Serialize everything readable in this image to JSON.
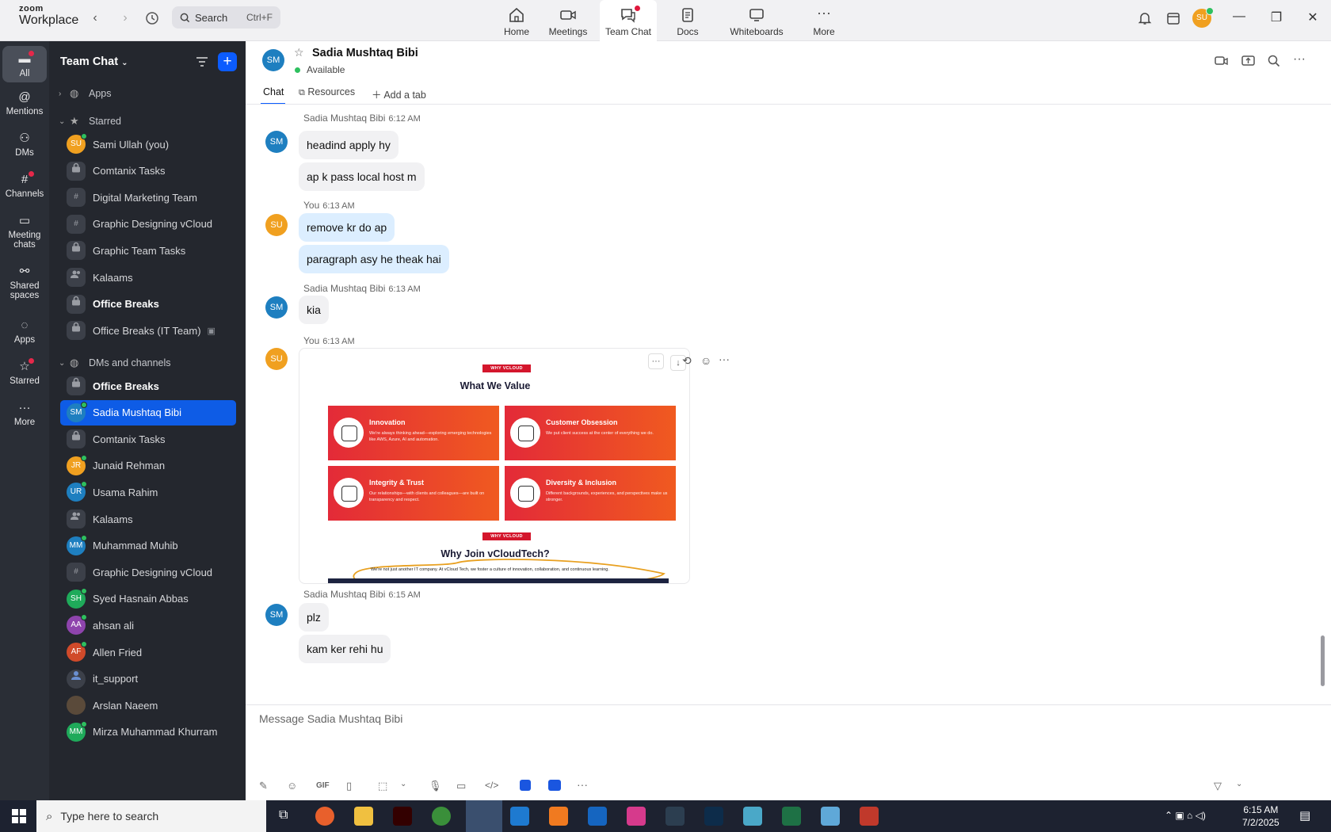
{
  "titlebar": {
    "brand_top": "zoom",
    "brand_bottom": "Workplace",
    "search_placeholder": "Search",
    "search_shortcut": "Ctrl+F",
    "avatar": "SU",
    "nav": [
      {
        "label": "Home"
      },
      {
        "label": "Meetings"
      },
      {
        "label": "Team Chat"
      },
      {
        "label": "Docs"
      },
      {
        "label": "Whiteboards"
      },
      {
        "label": "More"
      }
    ]
  },
  "rail": [
    {
      "label": "All"
    },
    {
      "label": "Mentions"
    },
    {
      "label": "DMs"
    },
    {
      "label": "Channels"
    },
    {
      "label": "Meeting chats"
    },
    {
      "label": "Shared spaces"
    },
    {
      "label": "Apps"
    },
    {
      "label": "Starred"
    },
    {
      "label": "More"
    }
  ],
  "sidebar": {
    "title": "Team Chat",
    "sections": {
      "apps": "Apps",
      "starred": "Starred",
      "dms": "DMs and channels"
    },
    "starred": [
      {
        "name": "Sami Ullah (you)",
        "initials": "SU",
        "color": "#f0a020"
      },
      {
        "name": "Comtanix Tasks",
        "icon": "lock"
      },
      {
        "name": "Digital Marketing Team",
        "icon": "hash"
      },
      {
        "name": "Graphic Designing vCloud",
        "icon": "hash"
      },
      {
        "name": "Graphic Team Tasks",
        "icon": "lock"
      },
      {
        "name": "Kalaams",
        "icon": "people"
      },
      {
        "name": "Office Breaks",
        "icon": "lock"
      },
      {
        "name": "Office Breaks (IT Team)",
        "icon": "lock"
      }
    ],
    "dms": [
      {
        "name": "Office Breaks",
        "icon": "lock"
      },
      {
        "name": "Sadia Mushtaq Bibi",
        "initials": "SM",
        "color": "#1e7fc0"
      },
      {
        "name": "Comtanix Tasks",
        "icon": "lock"
      },
      {
        "name": "Junaid Rehman",
        "initials": "JR",
        "color": "#f0a020"
      },
      {
        "name": "Usama Rahim",
        "initials": "UR",
        "color": "#1e7fc0"
      },
      {
        "name": "Kalaams",
        "icon": "people"
      },
      {
        "name": "Muhammad Muhib",
        "initials": "MM",
        "color": "#1e7fc0"
      },
      {
        "name": "Graphic Designing vCloud",
        "icon": "hash"
      },
      {
        "name": "Syed Hasnain Abbas",
        "initials": "SH",
        "color": "#1faa5a"
      },
      {
        "name": "ahsan ali",
        "initials": "AA",
        "color": "#8e44ad"
      },
      {
        "name": "Allen Fried",
        "initials": "AF",
        "color": "#d04a2a"
      },
      {
        "name": "it_support",
        "icon": "person"
      },
      {
        "name": "Arslan Naeem",
        "icon": "photo"
      },
      {
        "name": "Mirza Muhammad Khurram",
        "initials": "MM",
        "color": "#1faa5a"
      }
    ]
  },
  "chat": {
    "contact_initials": "SM",
    "contact_name": "Sadia Mushtaq Bibi",
    "status": "Available",
    "tabs": {
      "chat": "Chat",
      "resources": "Resources",
      "add": "Add a tab"
    },
    "messages": [
      {
        "sender": "Sadia Mushtaq Bibi",
        "time": "6:12 AM",
        "lines": [
          "headind apply hy",
          "ap  k pass local host m"
        ]
      },
      {
        "sender": "You",
        "time": "6:13 AM",
        "lines": [
          "remove kr do ap",
          "paragraph asy he theak hai"
        ]
      },
      {
        "sender": "Sadia Mushtaq Bibi",
        "time": "6:13 AM",
        "lines": [
          "kia"
        ]
      },
      {
        "sender": "You",
        "time": "6:13 AM",
        "lines": []
      },
      {
        "sender": "Sadia Mushtaq Bibi",
        "time": "6:15 AM",
        "lines": [
          "plz",
          "kam ker rehi hu"
        ]
      }
    ],
    "composer_placeholder": "Message Sadia Mushtaq Bibi",
    "gif": "GIF"
  },
  "image": {
    "tag": "WHY VCLOUD TECH?",
    "heading": "What We Value",
    "cards": [
      {
        "title": "Innovation",
        "desc": "We're always thinking ahead—exploring emerging technologies like AWS, Azure, AI and automation."
      },
      {
        "title": "Customer Obsession",
        "desc": "We put client success at the center of everything we do."
      },
      {
        "title": "Integrity & Trust",
        "desc": "Our relationships—with clients and colleagues—are built on transparency and respect."
      },
      {
        "title": "Diversity & Inclusion",
        "desc": "Different backgrounds, experiences, and perspectives make us stronger."
      }
    ],
    "tag2": "WHY VCLOUD TECH?",
    "heading2": "Why Join vCloudTech?",
    "subtext": "We're not just another IT company. At vCloud Tech, we foster a culture of innovation, collaboration, and continuous learning."
  },
  "taskbar": {
    "search": "Type here to search",
    "time": "6:15 AM",
    "date": "7/2/2025"
  }
}
